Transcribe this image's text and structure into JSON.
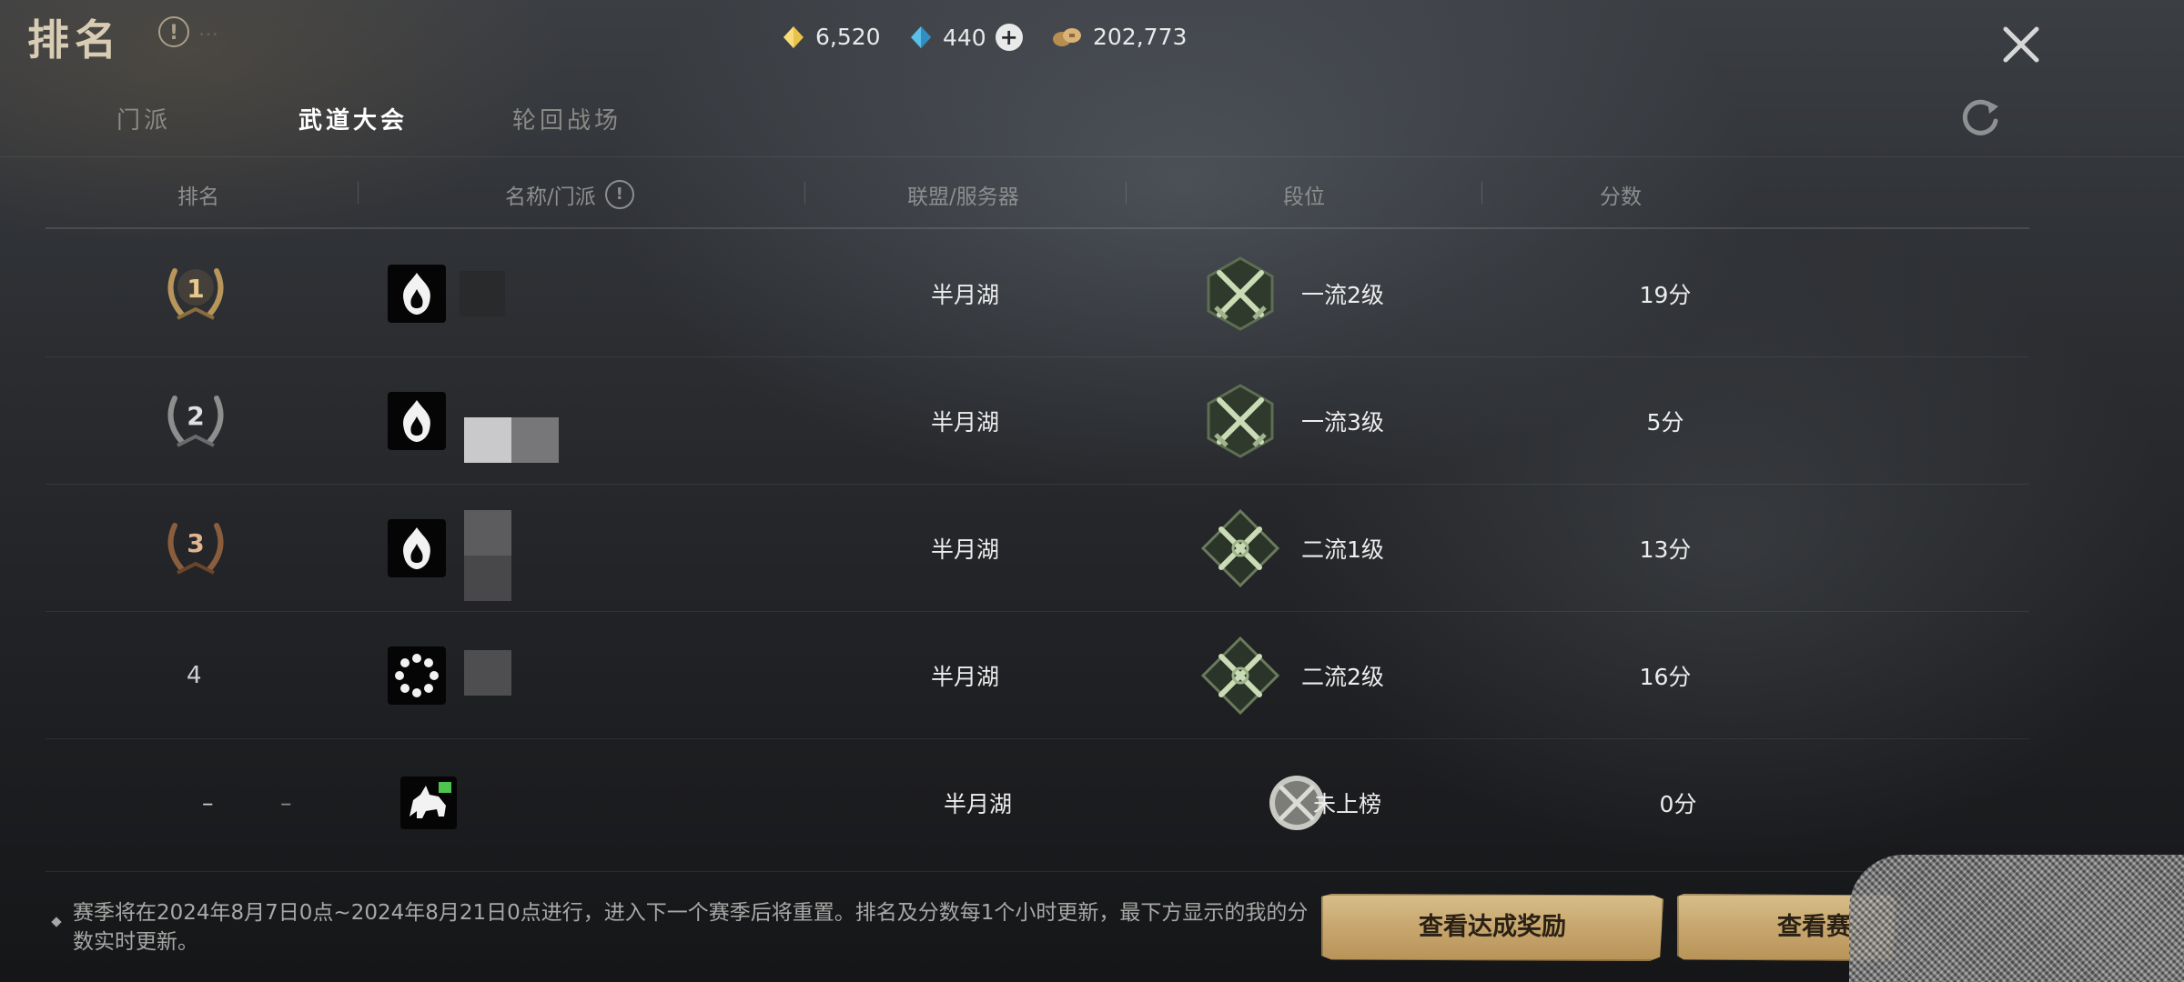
{
  "header": {
    "title": "排名",
    "info_icon_text": "!",
    "faded_text": "…",
    "currencies": [
      {
        "name": "gold-ingot",
        "value": "6,520",
        "color": "#e8c24a"
      },
      {
        "name": "blue-gem",
        "value": "440",
        "color": "#5bc0e8"
      },
      {
        "name": "copper-coins",
        "value": "202,773",
        "color": "#c9a46a"
      }
    ],
    "plus_symbol": "+"
  },
  "tabs": [
    {
      "label": "门派",
      "active": false
    },
    {
      "label": "武道大会",
      "active": true
    },
    {
      "label": "轮回战场",
      "active": false
    }
  ],
  "table": {
    "columns": [
      "排名",
      "名称/门派",
      "联盟/服务器",
      "段位",
      "分数"
    ],
    "column_info_icon": "!",
    "rows": [
      {
        "rank": "1",
        "rank_style": "gold-laurel",
        "sect_icon": "flame-sect-icon",
        "server": "半月湖",
        "tier": "一流2级",
        "tier_emblem": "crossed-swords-emblem",
        "score": "19分"
      },
      {
        "rank": "2",
        "rank_style": "silver-laurel",
        "sect_icon": "flame-sect-icon",
        "server": "半月湖",
        "tier": "一流3级",
        "tier_emblem": "crossed-swords-emblem",
        "score": "5分"
      },
      {
        "rank": "3",
        "rank_style": "bronze-laurel",
        "sect_icon": "flame-sect-icon",
        "server": "半月湖",
        "tier": "二流1级",
        "tier_emblem": "crossed-swords-diamond-emblem",
        "score": "13分"
      },
      {
        "rank": "4",
        "rank_style": "plain",
        "sect_icon": "beads-sect-icon",
        "server": "半月湖",
        "tier": "二流2级",
        "tier_emblem": "crossed-swords-diamond-emblem",
        "score": "16分"
      }
    ],
    "my_row": {
      "rank": "–",
      "rank_extra": "–",
      "sect_icon": "beast-sect-icon",
      "server": "半月湖",
      "tier": "未上榜",
      "tier_emblem": "unranked-emblem",
      "score": "0分"
    }
  },
  "footer": {
    "note": "赛季将在2024年8月7日0点~2024年8月21日0点进行，进入下一个赛季后将重置。排名及分数每1个小时更新，最下方显示的我的分数实时更新。",
    "btn_rewards": "查看达成奖励",
    "btn_season": "查看赛"
  }
}
